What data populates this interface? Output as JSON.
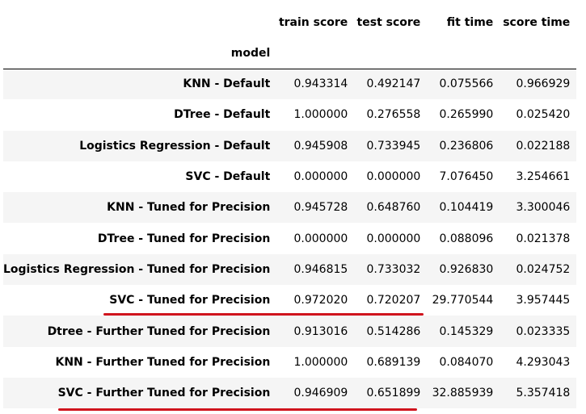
{
  "table": {
    "columns": [
      "train score",
      "test score",
      "fit time",
      "score time"
    ],
    "index_name": "model",
    "rows": [
      {
        "model": "KNN - Default",
        "train": "0.943314",
        "test": "0.492147",
        "fit": "0.075566",
        "score": "0.966929"
      },
      {
        "model": "DTree - Default",
        "train": "1.000000",
        "test": "0.276558",
        "fit": "0.265990",
        "score": "0.025420"
      },
      {
        "model": "Logistics Regression - Default",
        "train": "0.945908",
        "test": "0.733945",
        "fit": "0.236806",
        "score": "0.022188"
      },
      {
        "model": "SVC - Default",
        "train": "0.000000",
        "test": "0.000000",
        "fit": "7.076450",
        "score": "3.254661"
      },
      {
        "model": "KNN - Tuned for Precision",
        "train": "0.945728",
        "test": "0.648760",
        "fit": "0.104419",
        "score": "3.300046"
      },
      {
        "model": "DTree - Tuned for Precision",
        "train": "0.000000",
        "test": "0.000000",
        "fit": "0.088096",
        "score": "0.021378"
      },
      {
        "model": "Logistics Regression - Tuned for Precision",
        "train": "0.946815",
        "test": "0.733032",
        "fit": "0.926830",
        "score": "0.024752"
      },
      {
        "model": "SVC - Tuned for Precision",
        "train": "0.972020",
        "test": "0.720207",
        "fit": "29.770544",
        "score": "3.957445"
      },
      {
        "model": "Dtree - Further Tuned for Precision",
        "train": "0.913016",
        "test": "0.514286",
        "fit": "0.145329",
        "score": "0.023335"
      },
      {
        "model": "KNN - Further Tuned for Precision",
        "train": "1.000000",
        "test": "0.689139",
        "fit": "0.084070",
        "score": "4.293043"
      },
      {
        "model": "SVC - Further Tuned for Precision",
        "train": "0.946909",
        "test": "0.651899",
        "fit": "32.885939",
        "score": "5.357418"
      }
    ]
  },
  "annotations": {
    "underline_color": "#d0141d"
  }
}
